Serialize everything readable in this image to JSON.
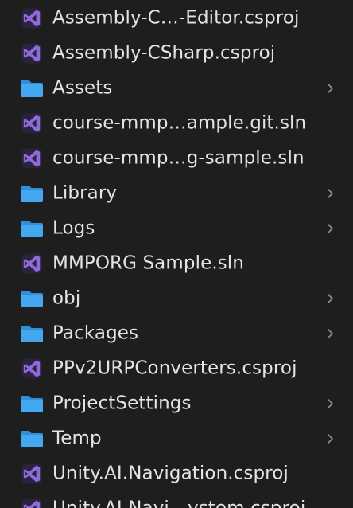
{
  "files": [
    {
      "name": "Assembly-C…-Editor.csproj",
      "kind": "vs-project",
      "icon": "visual-studio-icon"
    },
    {
      "name": "Assembly-CSharp.csproj",
      "kind": "vs-project",
      "icon": "visual-studio-icon"
    },
    {
      "name": "Assets",
      "kind": "folder",
      "icon": "folder-icon"
    },
    {
      "name": "course-mmp…ample.git.sln",
      "kind": "vs-project",
      "icon": "visual-studio-icon"
    },
    {
      "name": "course-mmp…g-sample.sln",
      "kind": "vs-project",
      "icon": "visual-studio-icon"
    },
    {
      "name": "Library",
      "kind": "folder",
      "icon": "folder-icon"
    },
    {
      "name": "Logs",
      "kind": "folder",
      "icon": "folder-icon"
    },
    {
      "name": "MMPORG Sample.sln",
      "kind": "vs-project",
      "icon": "visual-studio-icon"
    },
    {
      "name": "obj",
      "kind": "folder",
      "icon": "folder-icon"
    },
    {
      "name": "Packages",
      "kind": "folder",
      "icon": "folder-icon"
    },
    {
      "name": "PPv2URPConverters.csproj",
      "kind": "vs-project",
      "icon": "visual-studio-icon"
    },
    {
      "name": "ProjectSettings",
      "kind": "folder",
      "icon": "folder-icon"
    },
    {
      "name": "Temp",
      "kind": "folder",
      "icon": "folder-icon"
    },
    {
      "name": "Unity.AI.Navigation.csproj",
      "kind": "vs-project",
      "icon": "visual-studio-icon"
    },
    {
      "name": "Unity.AI.Navi…ystem.csproj",
      "kind": "vs-project",
      "icon": "visual-studio-icon"
    }
  ],
  "colors": {
    "background": "#1e1e1e",
    "text": "#e4e4e4",
    "folder": "#43a8f0",
    "folder_tab": "#2f8fd8",
    "visual_studio": "#8e6bd9",
    "chevron": "#8a8a8a"
  }
}
